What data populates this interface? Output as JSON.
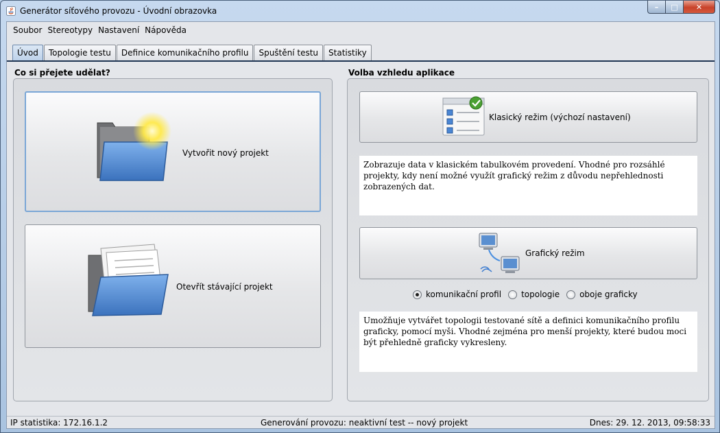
{
  "window": {
    "title": "Generátor síťového provozu - Úvodní obrazovka",
    "controls": {
      "minimize": "–",
      "maximize": "□",
      "close": "✕"
    }
  },
  "menu": [
    "Soubor",
    "Stereotypy",
    "Nastavení",
    "Nápověda"
  ],
  "tabs": [
    "Úvod",
    "Topologie testu",
    "Definice komunikačního profilu",
    "Spuštění testu",
    "Statistiky"
  ],
  "active_tab": "Úvod",
  "left_panel": {
    "title": "Co si přejete udělat?",
    "new_project_label": "Vytvořit nový projekt",
    "open_project_label": "Otevřít stávající projekt"
  },
  "right_panel": {
    "title": "Volba vzhledu aplikace",
    "classic_label": "Klasický režim (výchozí nastavení)",
    "classic_desc": "Zobrazuje data v klasickém tabulkovém provedení. Vhodné pro rozsáhlé projekty, kdy není možné využít grafický režim z důvodu nepřehlednosti zobrazených dat.",
    "graphic_label": "Grafický režim",
    "radio_options": [
      "komunikační profil",
      "topologie",
      "oboje graficky"
    ],
    "radio_selected": "komunikační profil",
    "graphic_desc": "Umožňuje vytvářet topologii testované sítě a definici komunikačního profilu graficky, pomocí myši. Vhodné zejména pro menší projekty, které budou moci být přehledně graficky vykresleny."
  },
  "status": {
    "ip": "IP statistika: 172.16.1.2",
    "traffic": "Generování provozu: neaktivní test -- nový projekt",
    "date": "Dnes: 29. 12. 2013, 09:58:33"
  },
  "colors": {
    "title_bar": "#b9d1ea",
    "active_tab": "#c6dbf0",
    "tab_line": "#1f3553",
    "focus_border": "#7aa6d6",
    "folder_blue": "#5b8fd1"
  }
}
